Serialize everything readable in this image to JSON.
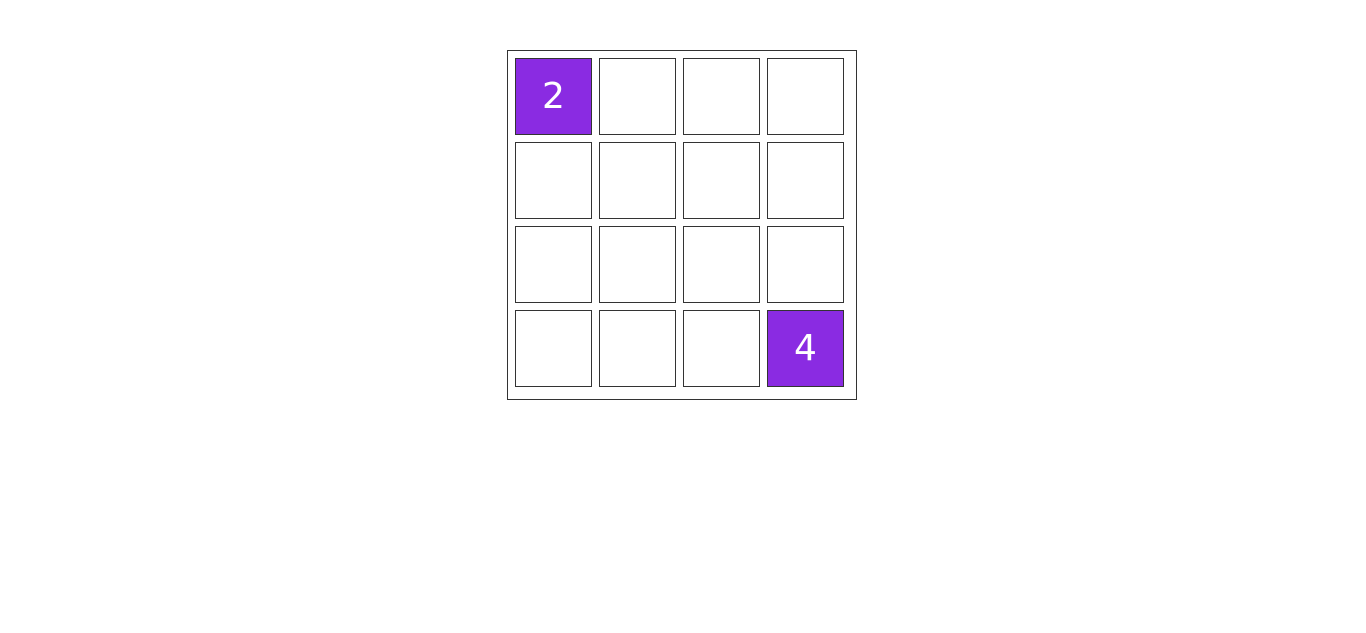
{
  "board": {
    "size": 4,
    "cells": [
      [
        "2",
        "",
        "",
        ""
      ],
      [
        "",
        "",
        "",
        ""
      ],
      [
        "",
        "",
        "",
        ""
      ],
      [
        "",
        "",
        "",
        "4"
      ]
    ]
  },
  "colors": {
    "tile_filled": "#8a2be2",
    "tile_text": "#ffffff",
    "border": "#333333"
  }
}
